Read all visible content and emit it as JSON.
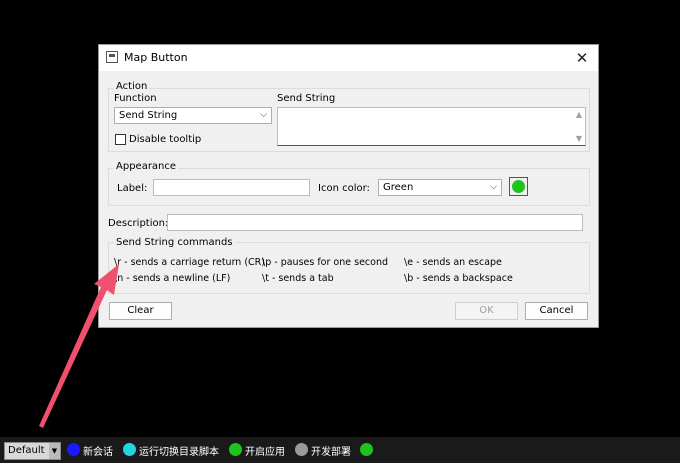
{
  "window": {
    "title": "Map Button",
    "icon": "app-window-icon"
  },
  "action": {
    "group_label": "Action",
    "function_label": "Function",
    "function_value": "Send String",
    "send_string_label": "Send String",
    "send_string_value": "",
    "disable_tooltip_label": "Disable tooltip",
    "disable_tooltip_checked": false
  },
  "appearance": {
    "group_label": "Appearance",
    "label_label": "Label:",
    "label_value": "",
    "icon_color_label": "Icon color:",
    "icon_color_value": "Green",
    "swatch_color": "#1ec31e"
  },
  "description": {
    "label": "Description:",
    "value": ""
  },
  "commands": {
    "group_label": "Send String commands",
    "items": [
      "\\r - sends a carriage return (CR)",
      "\\p - pauses for one second",
      "\\e - sends an escape",
      "\\n - sends a newline (LF)",
      "\\t - sends a tab",
      "\\b - sends a backspace"
    ]
  },
  "buttons": {
    "clear": "Clear",
    "ok": "OK",
    "cancel": "Cancel"
  },
  "taskbar": {
    "profile": "Default",
    "items": [
      {
        "label": "新会话",
        "color": "#1a1aff"
      },
      {
        "label": "运行切换目录脚本",
        "color": "#22d3e0"
      },
      {
        "label": "开启应用",
        "color": "#1ec31e"
      },
      {
        "label": "开发部署",
        "color": "#9a9a9a"
      },
      {
        "label": "",
        "color": "#1ec31e"
      }
    ]
  },
  "annotation": {
    "color": "#f0506e"
  }
}
